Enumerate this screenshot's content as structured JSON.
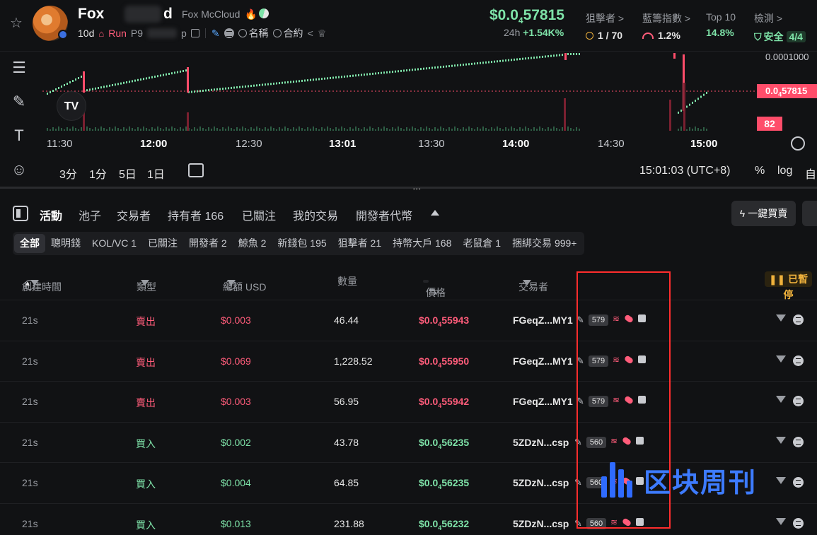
{
  "header": {
    "token_name_visible": "Fox",
    "token_name_tail": "d",
    "token_full_name": "Fox McCloud",
    "age": "10d",
    "run_label": "Run",
    "address_prefix": "P9",
    "address_suffix": "p",
    "name_search": "名稱",
    "contract_search": "合約",
    "price": "$0.0",
    "price_subscript": "4",
    "price_tail": "57815",
    "change_label": "24h",
    "change_value": "+1.54K%",
    "stats": [
      {
        "label": "狙擊者 >",
        "value": "1 / 70"
      },
      {
        "label": "藍籌指數 >",
        "value": "1.2%"
      },
      {
        "label": "Top 10",
        "value": "14.8%"
      },
      {
        "label": "檢測 >",
        "value": "安全",
        "badge": "4/4"
      }
    ]
  },
  "chart": {
    "top_axis_label": "0.0001000",
    "current_price_prefix": "0.0",
    "current_price_sub": "4",
    "current_price_tail": "57815",
    "volume_tag": "82",
    "time_labels": [
      {
        "text": "11:30",
        "strong": false
      },
      {
        "text": "12:00",
        "strong": true
      },
      {
        "text": "12:30",
        "strong": false
      },
      {
        "text": "13:01",
        "strong": true
      },
      {
        "text": "13:30",
        "strong": false
      },
      {
        "text": "14:00",
        "strong": true
      },
      {
        "text": "14:30",
        "strong": false
      },
      {
        "text": "15:00",
        "strong": true
      }
    ],
    "ranges": [
      "3分",
      "1分",
      "5日",
      "1日"
    ],
    "clock": "15:01:03 (UTC+8)",
    "pct_label": "%",
    "log_label": "log",
    "auto_label": "自"
  },
  "tabs": {
    "items": [
      "活動",
      "池子",
      "交易者",
      "持有者 166",
      "已關注",
      "我的交易",
      "開發者代幣"
    ],
    "buy_button": "一鍵買賣"
  },
  "filters": [
    "全部",
    "聰明錢",
    "KOL/VC 1",
    "已關注",
    "開發者 2",
    "鯨魚 2",
    "新錢包 195",
    "狙擊者 21",
    "持幣大戶 168",
    "老鼠倉 1",
    "捆綁交易 999+"
  ],
  "table": {
    "headers": {
      "time": "創建時間",
      "type": "類型",
      "total": "總額 USD",
      "qty": "數量",
      "price": "價格",
      "trader": "交易者"
    },
    "paused_label": "已暫停",
    "rows": [
      {
        "time": "21s",
        "type": "賣出",
        "side": "sell",
        "total": "$0.003",
        "qty": "46.44",
        "price_prefix": "$0.0",
        "price_sub": "4",
        "price_tail": "55943",
        "trader": "FGeqZ...MY1",
        "count": "579"
      },
      {
        "time": "21s",
        "type": "賣出",
        "side": "sell",
        "total": "$0.069",
        "qty": "1,228.52",
        "price_prefix": "$0.0",
        "price_sub": "4",
        "price_tail": "55950",
        "trader": "FGeqZ...MY1",
        "count": "579"
      },
      {
        "time": "21s",
        "type": "賣出",
        "side": "sell",
        "total": "$0.003",
        "qty": "56.95",
        "price_prefix": "$0.0",
        "price_sub": "4",
        "price_tail": "55942",
        "trader": "FGeqZ...MY1",
        "count": "579"
      },
      {
        "time": "21s",
        "type": "買入",
        "side": "buy",
        "total": "$0.002",
        "qty": "43.78",
        "price_prefix": "$0.0",
        "price_sub": "4",
        "price_tail": "56235",
        "trader": "5ZDzN...csp",
        "count": "560"
      },
      {
        "time": "21s",
        "type": "買入",
        "side": "buy",
        "total": "$0.004",
        "qty": "64.85",
        "price_prefix": "$0.0",
        "price_sub": "4",
        "price_tail": "56235",
        "trader": "5ZDzN...csp",
        "count": "560"
      },
      {
        "time": "21s",
        "type": "買入",
        "side": "buy",
        "total": "$0.013",
        "qty": "231.88",
        "price_prefix": "$0.0",
        "price_sub": "4",
        "price_tail": "56232",
        "trader": "5ZDzN...csp",
        "count": "560"
      }
    ]
  },
  "watermark": "区块周刊",
  "colors": {
    "up": "#7ee2a8",
    "down": "#ff5c7a",
    "accent": "#ff2d2d"
  }
}
